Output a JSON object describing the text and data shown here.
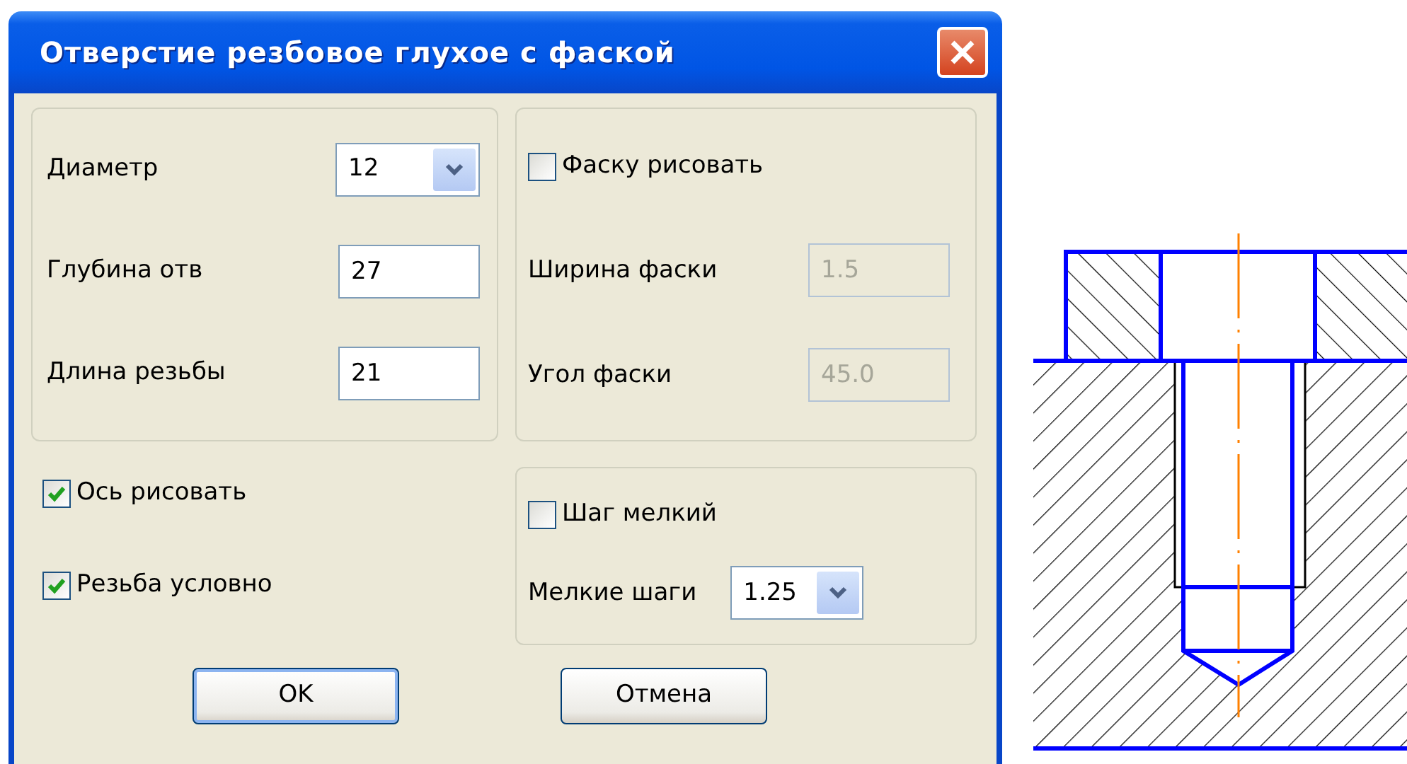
{
  "dialog": {
    "title": "Отверстие резбовое глухое с фаской"
  },
  "size_group": {
    "fields": [
      {
        "kind": "combo",
        "label": "Диаметр",
        "value": "12"
      },
      {
        "kind": "input",
        "label": "Глубина отв",
        "value": "27"
      },
      {
        "kind": "input",
        "label": "Длина резьбы",
        "value": "21"
      }
    ]
  },
  "chamfer_group": {
    "checkbox": {
      "label": "Фаску рисовать",
      "checked": false
    },
    "fields": [
      {
        "kind": "input",
        "label": "Ширина фаски",
        "value": "1.5",
        "disabled": true
      },
      {
        "kind": "input",
        "label": "Угол фаски",
        "value": "45.0",
        "disabled": true
      }
    ]
  },
  "options": [
    {
      "label": "Ось рисовать",
      "checked": true
    },
    {
      "label": "Резьба условно",
      "checked": true
    }
  ],
  "pitch_group": {
    "checkbox": {
      "label": "Шаг мелкий",
      "checked": false
    },
    "fields": [
      {
        "kind": "combo",
        "label": "Мелкие шаги",
        "value": "1.25"
      }
    ]
  },
  "buttons": [
    {
      "label": "OK",
      "default": true
    },
    {
      "label": "Отмена",
      "default": false
    }
  ]
}
